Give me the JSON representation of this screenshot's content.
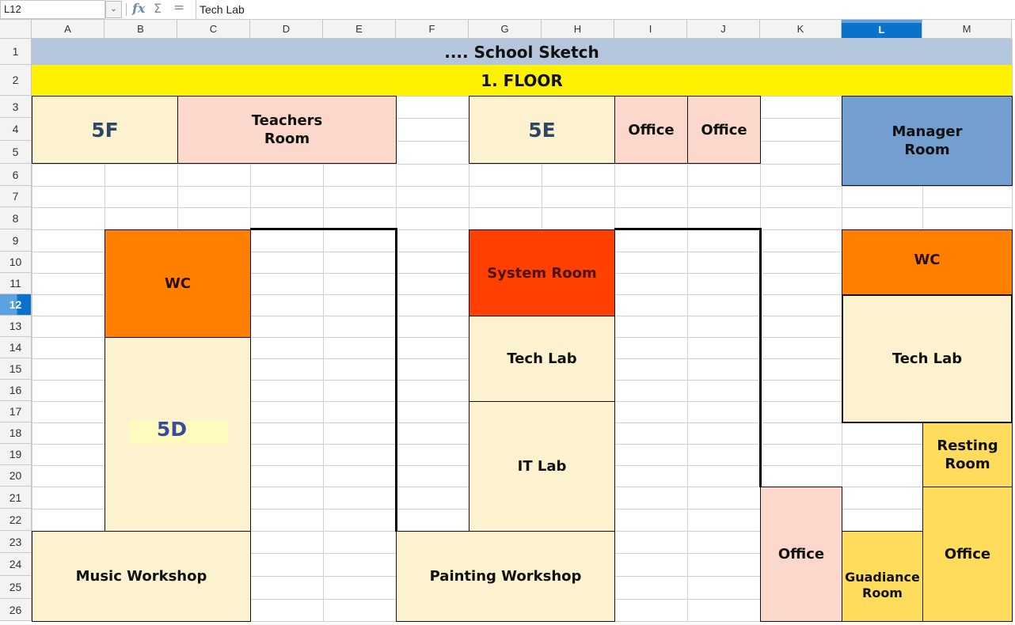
{
  "formula_bar": {
    "name_box": "L12",
    "dropdown_icon": "chevron-down-icon",
    "function_icon": "fx",
    "sum_icon": "Σ",
    "equals_icon": "=",
    "content": "Tech Lab"
  },
  "columns": [
    "A",
    "B",
    "C",
    "D",
    "E",
    "F",
    "G",
    "H",
    "I",
    "J",
    "K",
    "L",
    "M"
  ],
  "selected_column": "L",
  "rows": [
    "1",
    "2",
    "3",
    "4",
    "5",
    "6",
    "7",
    "8",
    "9",
    "10",
    "11",
    "12",
    "13",
    "14",
    "15",
    "16",
    "17",
    "18",
    "19",
    "20",
    "21",
    "22",
    "23",
    "24",
    "25",
    "26"
  ],
  "selected_row": "12",
  "sheet": {
    "title": ".... School Sketch",
    "floor": "1. FLOOR",
    "colors": {
      "title_band": "#b4c6dc",
      "floor_band": "#fff200",
      "classroom": "#fdf2d0",
      "office_pink": "#fcd8cc",
      "manager_blue": "#729fcf",
      "wc_orange": "#ff8000",
      "system_red": "#ff4000",
      "yellow_room": "#ffdc5c"
    },
    "rooms": {
      "r5f": "5F",
      "teachers": "Teachers\nRoom",
      "r5e": "5E",
      "office_i": "Office",
      "office_j": "Office",
      "manager": "Manager\nRoom",
      "wc_left": "WC",
      "r5d": "5D",
      "system": "System Room",
      "techlab_mid": "Tech Lab",
      "itlab": "IT Lab",
      "wc_right": "WC",
      "techlab_right": "Tech Lab",
      "resting": "Resting\nRoom",
      "office_k": "Office",
      "guidance": "Guadiance\nRoom",
      "office_m": "Office",
      "music": "Music Workshop",
      "painting": "Painting Workshop"
    }
  }
}
